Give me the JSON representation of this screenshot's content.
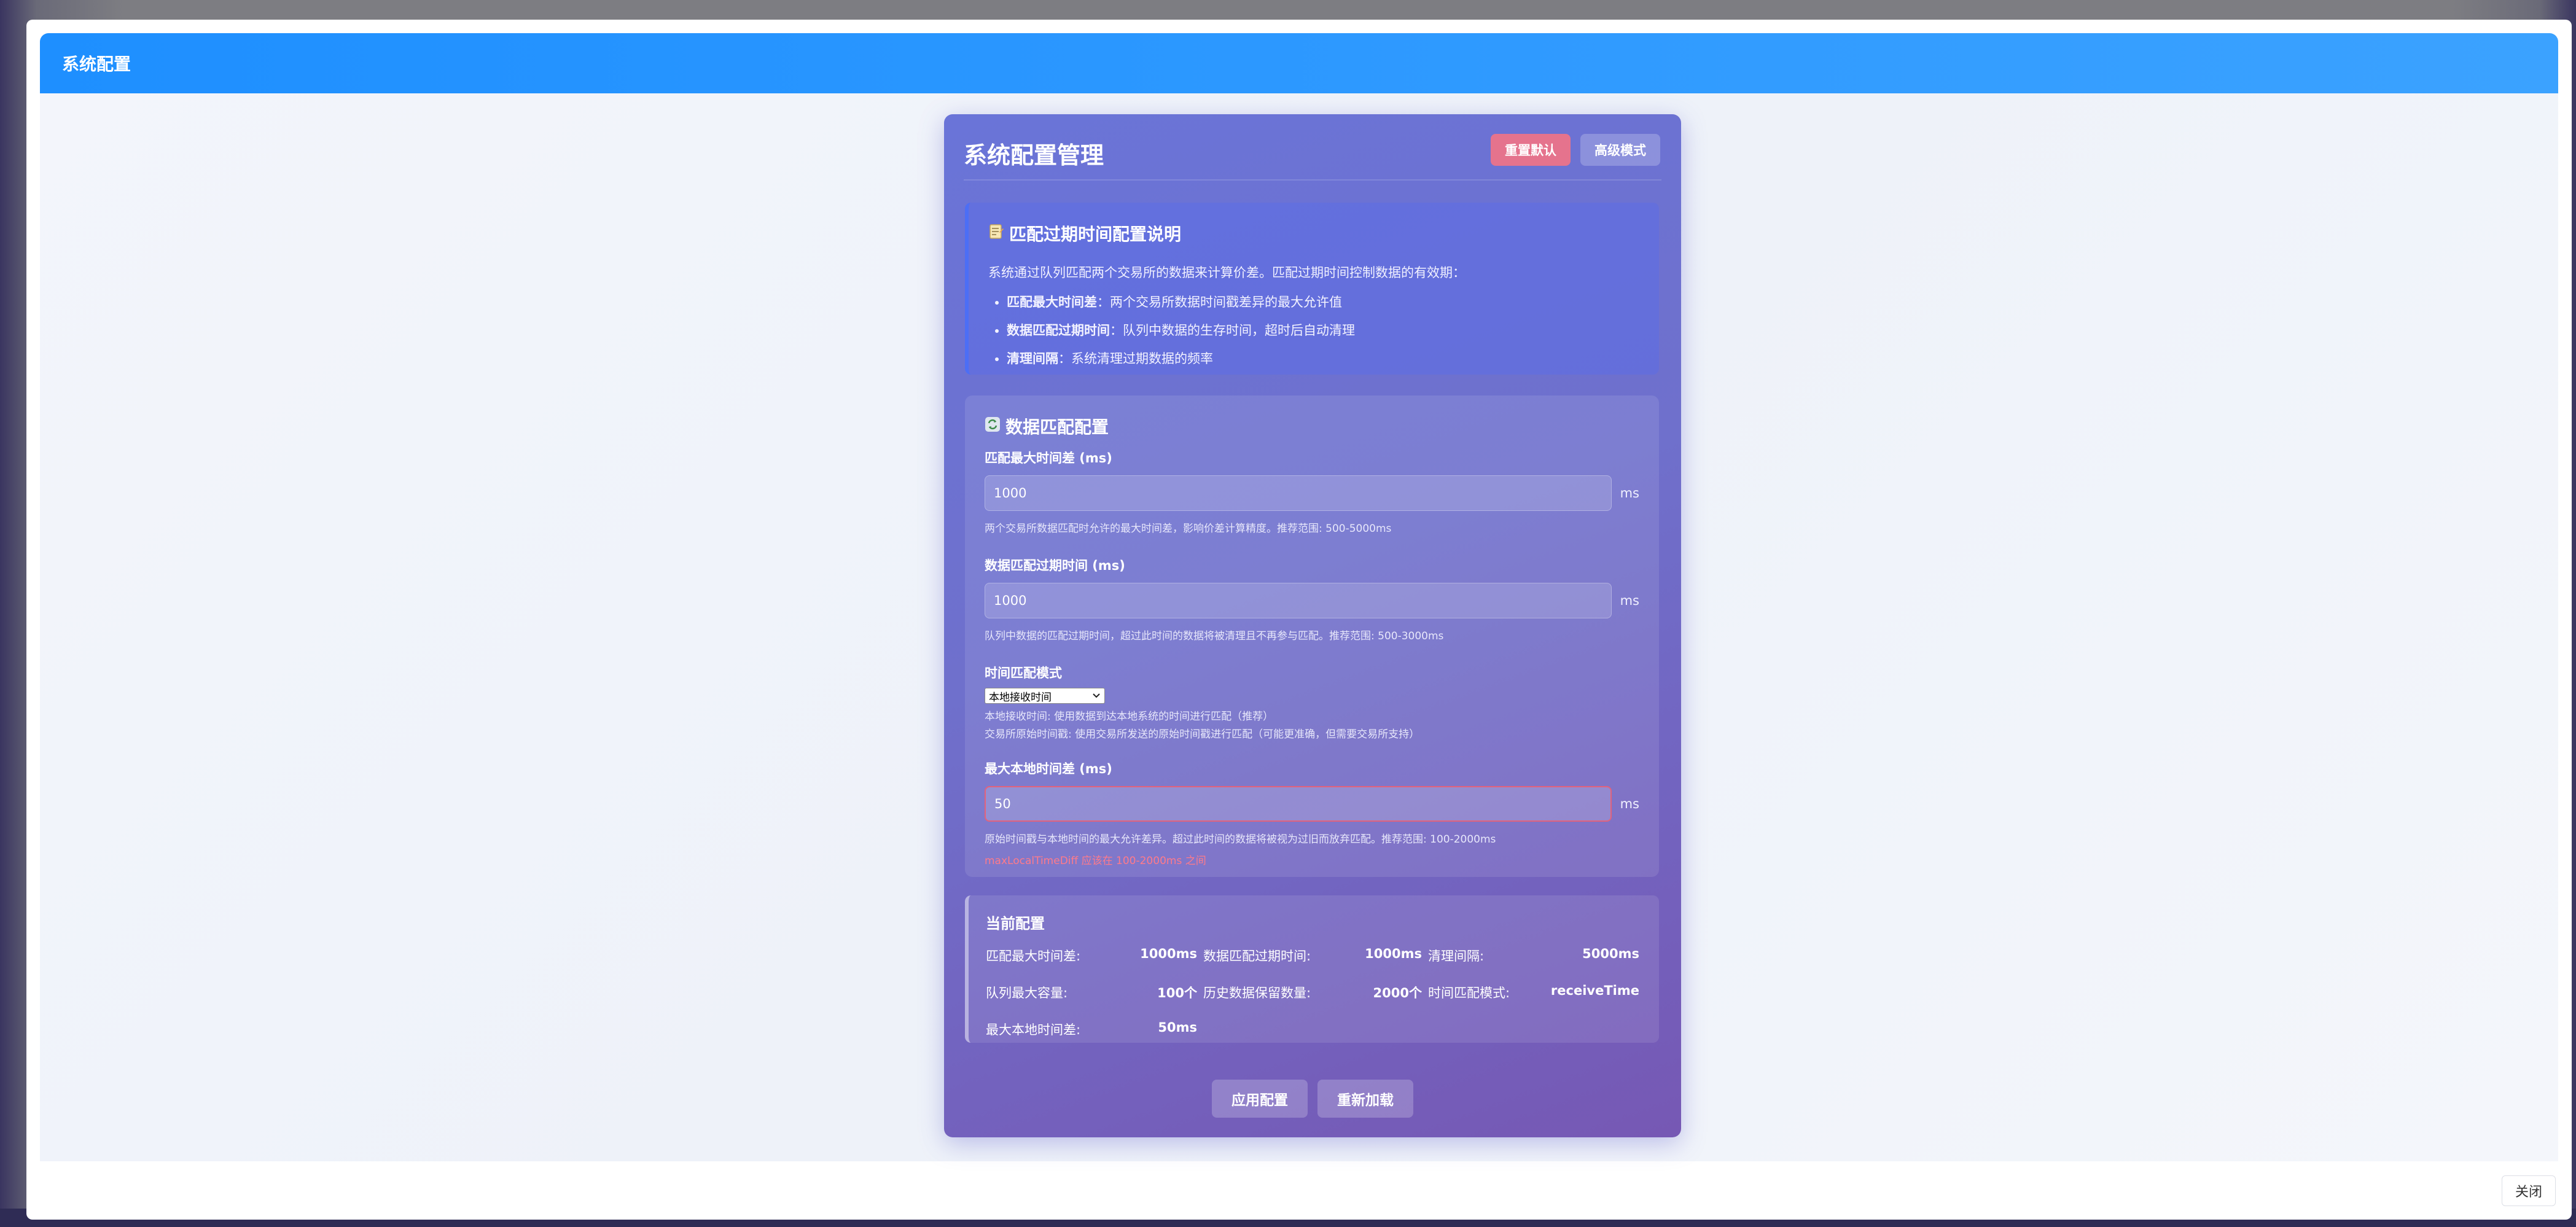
{
  "modal": {
    "title": "系统配置",
    "close_label": "关闭"
  },
  "panel": {
    "title": "系统配置管理",
    "reset_label": "重置默认",
    "advanced_label": "高级模式"
  },
  "info": {
    "icon": "memo-icon",
    "title": "匹配过期时间配置说明",
    "description": "系统通过队列匹配两个交易所的数据来计算价差。匹配过期时间控制数据的有效期：",
    "items": [
      {
        "term": "匹配最大时间差",
        "text": "：两个交易所数据时间戳差异的最大允许值"
      },
      {
        "term": "数据匹配过期时间",
        "text": "：队列中数据的生存时间，超时后自动清理"
      },
      {
        "term": "清理间隔",
        "text": "：系统清理过期数据的频率"
      }
    ]
  },
  "matching": {
    "icon": "refresh-icon",
    "title": "数据匹配配置",
    "max_time_diff": {
      "label": "匹配最大时间差 (ms)",
      "value": "1000",
      "unit": "ms",
      "hint": "两个交易所数据匹配时允许的最大时间差，影响价差计算精度。推荐范围: 500-5000ms"
    },
    "expire_time": {
      "label": "数据匹配过期时间 (ms)",
      "value": "1000",
      "unit": "ms",
      "hint": "队列中数据的匹配过期时间，超过此时间的数据将被清理且不再参与匹配。推荐范围: 500-3000ms"
    },
    "match_mode": {
      "label": "时间匹配模式",
      "selected": "本地接收时间",
      "hint_line1": "本地接收时间: 使用数据到达本地系统的时间进行匹配（推荐）",
      "hint_line2": "交易所原始时间戳: 使用交易所发送的原始时间戳进行匹配（可能更准确，但需要交易所支持）"
    },
    "max_local_diff": {
      "label": "最大本地时间差 (ms)",
      "value": "50",
      "unit": "ms",
      "hint": "原始时间戳与本地时间的最大允许差异。超过此时间的数据将被视为过旧而放弃匹配。推荐范围: 100-2000ms",
      "error": "maxLocalTimeDiff 应该在 100-2000ms 之间"
    }
  },
  "current": {
    "title": "当前配置",
    "items": [
      {
        "label": "匹配最大时间差:",
        "value": "1000ms"
      },
      {
        "label": "数据匹配过期时间:",
        "value": "1000ms"
      },
      {
        "label": "清理间隔:",
        "value": "5000ms"
      },
      {
        "label": "队列最大容量:",
        "value": "100个"
      },
      {
        "label": "历史数据保留数量:",
        "value": "2000个"
      },
      {
        "label": "时间匹配模式:",
        "value": "receiveTime"
      },
      {
        "label": "最大本地时间差:",
        "value": "50ms"
      }
    ]
  },
  "actions": {
    "apply_label": "应用配置",
    "reload_label": "重新加载"
  },
  "colors": {
    "header_blue": "#1e8fff",
    "panel_purple": "#6f70cc",
    "danger": "#e5738d",
    "error_text": "#ff7a8a"
  }
}
